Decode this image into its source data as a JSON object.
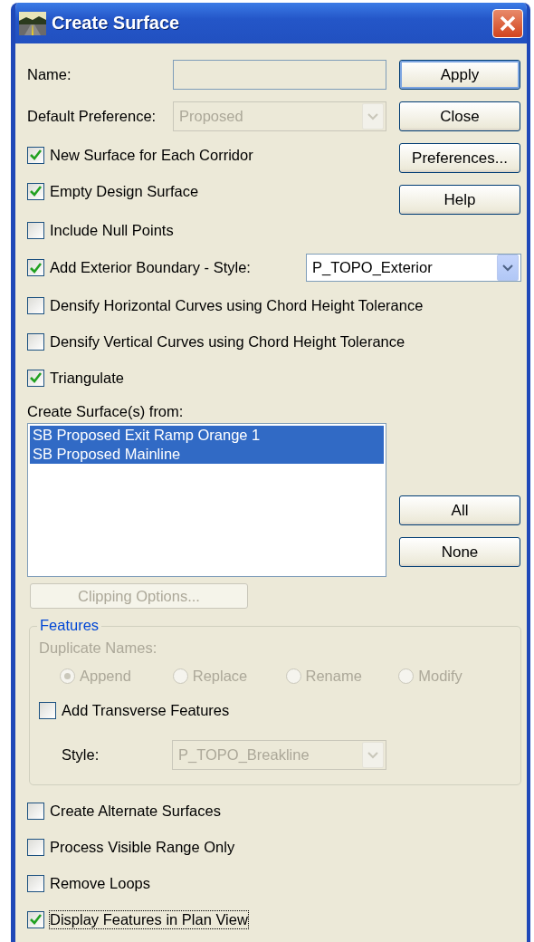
{
  "window": {
    "title": "Create Surface"
  },
  "name_field": {
    "label": "Name:"
  },
  "default_preference": {
    "label": "Default Preference:",
    "value": "Proposed",
    "disabled": true
  },
  "buttons": [
    {
      "label": "Apply",
      "default": true
    },
    {
      "label": "Close",
      "default": false
    },
    {
      "label": "Preferences...",
      "default": false
    },
    {
      "label": "Help",
      "default": false
    }
  ],
  "options": [
    {
      "label": "New Surface for Each Corridor",
      "checked": true
    },
    {
      "label": "Empty Design Surface",
      "checked": true
    },
    {
      "label": "Include Null Points",
      "checked": false
    },
    {
      "label": "Add Exterior Boundary - Style:",
      "checked": true,
      "style": {
        "value": "P_TOPO_Exterior"
      }
    },
    {
      "label": "Densify Horizontal Curves using Chord Height Tolerance",
      "checked": false
    },
    {
      "label": "Densify Vertical Curves using Chord Height Tolerance",
      "checked": false
    },
    {
      "label": "Triangulate",
      "checked": true
    }
  ],
  "source_list": {
    "label": "Create Surface(s) from:",
    "items": [
      {
        "label": "SB Proposed Exit Ramp Orange 1",
        "selected": true
      },
      {
        "label": "SB Proposed Mainline",
        "selected": true
      }
    ]
  },
  "list_buttons": [
    "All",
    "None"
  ],
  "clipping_button": {
    "label": "Clipping Options...",
    "disabled": true
  },
  "features": {
    "title": "Features",
    "duplicate_names": {
      "label": "Duplicate Names:",
      "disabled": true,
      "options": [
        {
          "label": "Append",
          "selected": true
        },
        {
          "label": "Replace",
          "selected": false
        },
        {
          "label": "Rename",
          "selected": false
        },
        {
          "label": "Modify",
          "selected": false
        }
      ]
    },
    "transverse": {
      "label": "Add Transverse Features",
      "checked": false
    },
    "style": {
      "label": "Style:",
      "value": "P_TOPO_Breakline",
      "disabled": true
    }
  },
  "bottom_options": [
    {
      "label": "Create Alternate Surfaces",
      "checked": false,
      "focused": false
    },
    {
      "label": "Process Visible Range Only",
      "checked": false,
      "focused": false
    },
    {
      "label": "Remove Loops",
      "checked": false,
      "focused": false
    },
    {
      "label": "Display Features in Plan View",
      "checked": true,
      "focused": true
    }
  ]
}
